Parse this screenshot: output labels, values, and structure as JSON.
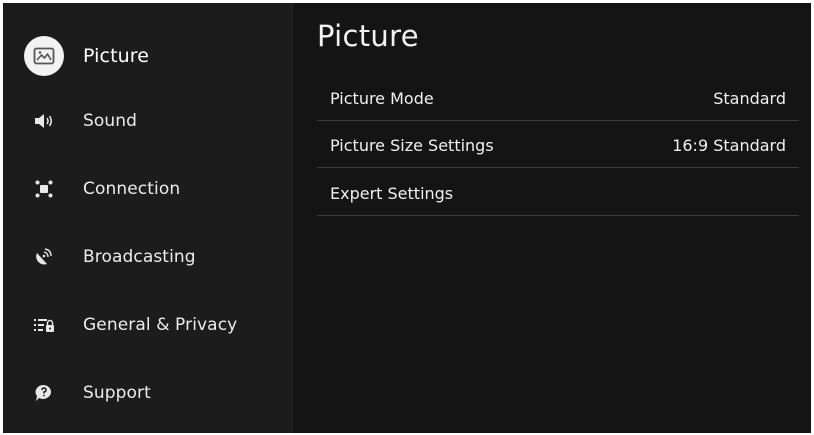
{
  "sidebar": {
    "items": [
      {
        "label": "Picture",
        "icon": "picture-icon",
        "active": true
      },
      {
        "label": "Sound",
        "icon": "speaker-icon"
      },
      {
        "label": "Connection",
        "icon": "connection-icon"
      },
      {
        "label": "Broadcasting",
        "icon": "broadcast-dish-icon"
      },
      {
        "label": "General & Privacy",
        "icon": "general-privacy-icon"
      },
      {
        "label": "Support",
        "icon": "support-icon"
      }
    ]
  },
  "main": {
    "title": "Picture",
    "rows": [
      {
        "label": "Picture Mode",
        "value": "Standard"
      },
      {
        "label": "Picture Size Settings",
        "value": "16:9 Standard"
      },
      {
        "label": "Expert Settings",
        "value": ""
      }
    ]
  },
  "colors": {
    "background": "#161616",
    "sidebar": "#1c1c1c",
    "active_icon_bg": "#f2f2f2",
    "text": "#f0f0f0",
    "separator": "#3a3a3a"
  }
}
